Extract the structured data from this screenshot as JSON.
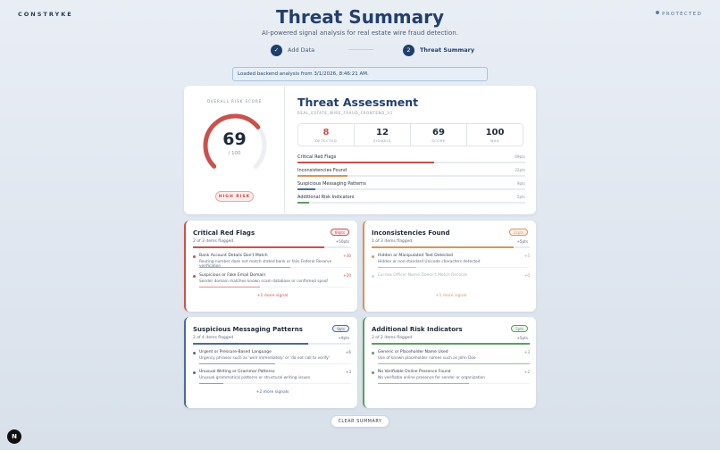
{
  "brand": "CONSTRYKE",
  "status": "PROTECTED",
  "header": {
    "title": "Threat Summary",
    "subtitle": "AI-powered signal analysis for real estate wire fraud detection."
  },
  "steps": [
    {
      "label": "Add Data",
      "icon": "✓",
      "state": "done"
    },
    {
      "label": "Threat Summary",
      "icon": "2",
      "state": "active"
    }
  ],
  "notice": "Loaded backend analysis from 3/1/2026, 8:46:21 AM.",
  "score": {
    "label": "OVERALL RISK SCORE",
    "value": "69",
    "max": "/ 100",
    "fraction": 0.69,
    "risk_label": "HIGH RISK",
    "color": "#c9524c"
  },
  "assessment": {
    "title": "Threat Assessment",
    "tags": "REAL_ESTATE_WIRE_FRAUD_FRONTEND_V1",
    "stats": [
      {
        "value": "8",
        "label": "DETECTED"
      },
      {
        "value": "12",
        "label": "SIGNALS"
      },
      {
        "value": "69",
        "label": "SCORE"
      },
      {
        "value": "100",
        "label": "MAX"
      }
    ],
    "categories": [
      {
        "name": "Critical Red Flags",
        "pts": "69pts",
        "fraction": 0.6,
        "color": "#c9524c"
      },
      {
        "name": "Inconsistencies Found",
        "pts": "22pts",
        "fraction": 0.22,
        "color": "#d9955a"
      },
      {
        "name": "Suspicious Messaging Patterns",
        "pts": "9pts",
        "fraction": 0.08,
        "color": "#4b6b95"
      },
      {
        "name": "Additional Risk Indicators",
        "pts": "5pts",
        "fraction": 0.05,
        "color": "#5aa05c"
      }
    ]
  },
  "sections": [
    {
      "title": "Critical Red Flags",
      "badge": "69pts",
      "color": "#c9524c",
      "badge_bg": "#fdeeed",
      "flagged": "2 of 3 items flagged",
      "points": "+50pts",
      "fraction": 0.83,
      "items": [
        {
          "title": "Bank Account Details Don't Match",
          "desc": "Routing number does not match stated bank or fails Federal Reserve verification",
          "pts": "+30",
          "fraction": 0.6,
          "dim": false
        },
        {
          "title": "Suspicious or Fake Email Domain",
          "desc": "Sender domain matches known scam database or confirmed spoof",
          "pts": "+20",
          "fraction": 0.4,
          "dim": false
        }
      ],
      "more": "+1 more signal"
    },
    {
      "title": "Inconsistencies Found",
      "badge": "22pts",
      "color": "#d9955a",
      "badge_bg": "#fdf3ea",
      "flagged": "1 of 3 items flagged",
      "points": "+5pts",
      "fraction": 0.9,
      "items": [
        {
          "title": "Hidden or Manipulated Text Detected",
          "desc": "Hidden or non-standard Unicode characters detected",
          "pts": "+5",
          "fraction": 0.25,
          "dim": false
        },
        {
          "title": "Escrow Officer Name Doesn't Match Records",
          "desc": "",
          "pts": "+0",
          "fraction": 0,
          "dim": true
        }
      ],
      "more": "+1 more signal"
    },
    {
      "title": "Suspicious Messaging Patterns",
      "badge": "9pts",
      "color": "#4b6b95",
      "badge_bg": "#eef2f8",
      "flagged": "2 of 4 items flagged",
      "points": "+9pts",
      "fraction": 0.73,
      "items": [
        {
          "title": "Urgent or Pressure-Based Language",
          "desc": "Urgency phrases such as 'wire immediately' or 'do not call to verify'",
          "pts": "+6",
          "fraction": 0.5,
          "dim": false
        },
        {
          "title": "Unusual Writing or Grammar Patterns",
          "desc": "Unusual grammatical patterns or structural writing issues",
          "pts": "+3",
          "fraction": 0.16,
          "dim": false
        }
      ],
      "more": "+2 more signals"
    },
    {
      "title": "Additional Risk Indicators",
      "badge": "5pts",
      "color": "#5aa05c",
      "badge_bg": "#edf7ee",
      "flagged": "2 of 2 items flagged",
      "points": "+5pts",
      "fraction": 1.0,
      "items": [
        {
          "title": "Generic or Placeholder Name Used",
          "desc": "Use of known placeholder names such as John Doe",
          "pts": "+3",
          "fraction": 1.0,
          "dim": false
        },
        {
          "title": "No Verifiable Online Presence Found",
          "desc": "No verifiable online presence for sender or organization",
          "pts": "+2",
          "fraction": 0.6,
          "dim": false
        }
      ],
      "more": ""
    }
  ],
  "clear_label": "CLEAR SUMMARY",
  "corner_logo": "N"
}
